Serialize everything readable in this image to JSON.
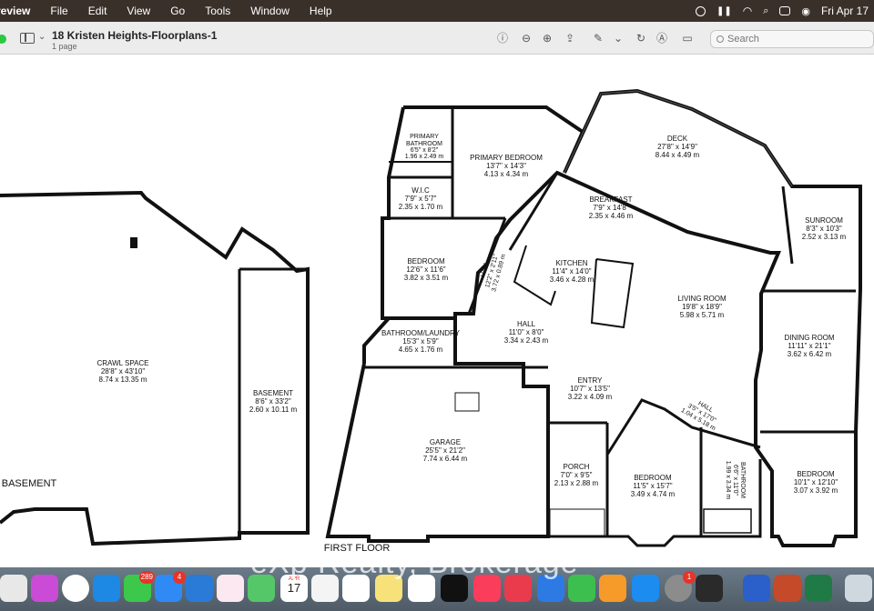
{
  "menubar": {
    "app_name": "Preview",
    "items": [
      "File",
      "Edit",
      "View",
      "Go",
      "Tools",
      "Window",
      "Help"
    ],
    "clock": "Fri Apr 17"
  },
  "toolbar": {
    "doc_title": "18 Kristen Heights-Floorplans-1",
    "doc_pages": "1 page",
    "search_placeholder": "Search"
  },
  "floorplan": {
    "basement_label": "BASEMENT",
    "first_floor_label": "FIRST FLOOR",
    "rooms": [
      {
        "name": "CRAWL SPACE",
        "imperial": "28'8\" x 43'10\"",
        "metric": "8.74 x 13.35 m"
      },
      {
        "name": "BASEMENT",
        "imperial": "8'6\" x 33'2\"",
        "metric": "2.60 x 10.11 m"
      },
      {
        "name": "PRIMARY",
        "name2": "BATHROOM",
        "imperial": "6'5\" x 8'2\"",
        "metric": "1.96 x 2.49 m"
      },
      {
        "name": "PRIMARY BEDROOM",
        "imperial": "13'7\" x 14'3\"",
        "metric": "4.13 x 4.34 m"
      },
      {
        "name": "W.I.C",
        "imperial": "7'9\" x 5'7\"",
        "metric": "2.35 x 1.70 m"
      },
      {
        "name": "DECK",
        "imperial": "27'8\" x 14'9\"",
        "metric": "8.44 x 4.49 m"
      },
      {
        "name": "BREAKFAST",
        "imperial": "7'9\" x 14'8\"",
        "metric": "2.35 x 4.46 m"
      },
      {
        "name": "SUNROOM",
        "imperial": "8'3\" x 10'3\"",
        "metric": "2.52 x 3.13 m"
      },
      {
        "name": "BEDROOM",
        "imperial": "12'6\" x 11'6\"",
        "metric": "3.82 x 3.51 m"
      },
      {
        "name": "KITCHEN",
        "imperial": "11'4\" x 14'0\"",
        "metric": "3.46 x 4.28 m"
      },
      {
        "name": "LIVING ROOM",
        "imperial": "19'8\" x 18'9\"",
        "metric": "5.98 x 5.71 m"
      },
      {
        "name": "BATHROOM/LAUNDRY",
        "imperial": "15'3\" x 5'9\"",
        "metric": "4.65 x 1.76 m"
      },
      {
        "name": "HALL",
        "imperial": "11'0\" x 8'0\"",
        "metric": "3.34 x 2.43 m"
      },
      {
        "name": "DINING ROOM",
        "imperial": "11'11\" x 21'1\"",
        "metric": "3.62 x 6.42 m"
      },
      {
        "name": "ENTRY",
        "imperial": "10'7\" x 13'5\"",
        "metric": "3.22 x 4.09 m"
      },
      {
        "name": "GARAGE",
        "imperial": "25'5\" x 21'2\"",
        "metric": "7.74 x 6.44 m"
      },
      {
        "name": "PORCH",
        "imperial": "7'0\" x 9'5\"",
        "metric": "2.13 x 2.88 m"
      },
      {
        "name": "BEDROOM",
        "imperial": "11'5\" x 15'7\"",
        "metric": "3.49 x 4.74 m"
      },
      {
        "name": "BEDROOM",
        "imperial": "10'1\" x 12'10\"",
        "metric": "3.07 x 3.92 m"
      }
    ],
    "hall_small": {
      "name": "HALL",
      "imperial": "12'2\" x 2'11\"",
      "metric": "3.72 x 0.89 m"
    },
    "hall_diag": {
      "name": "HALL",
      "imperial": "3'5\" x 17'0\"",
      "metric": "1.04 x 5.18 m"
    },
    "bathroom_vert": {
      "name": "BATHROOM",
      "imperial": "6'6\" x 11'0\"",
      "metric": "1.99 x 3.34 m"
    }
  },
  "dock": {
    "badges": {
      "messages": "289",
      "mail": "4",
      "calendar_day": "17",
      "calendar_month": "APR",
      "system": "1"
    }
  },
  "watermark": "eXp Realty, Brokerage"
}
